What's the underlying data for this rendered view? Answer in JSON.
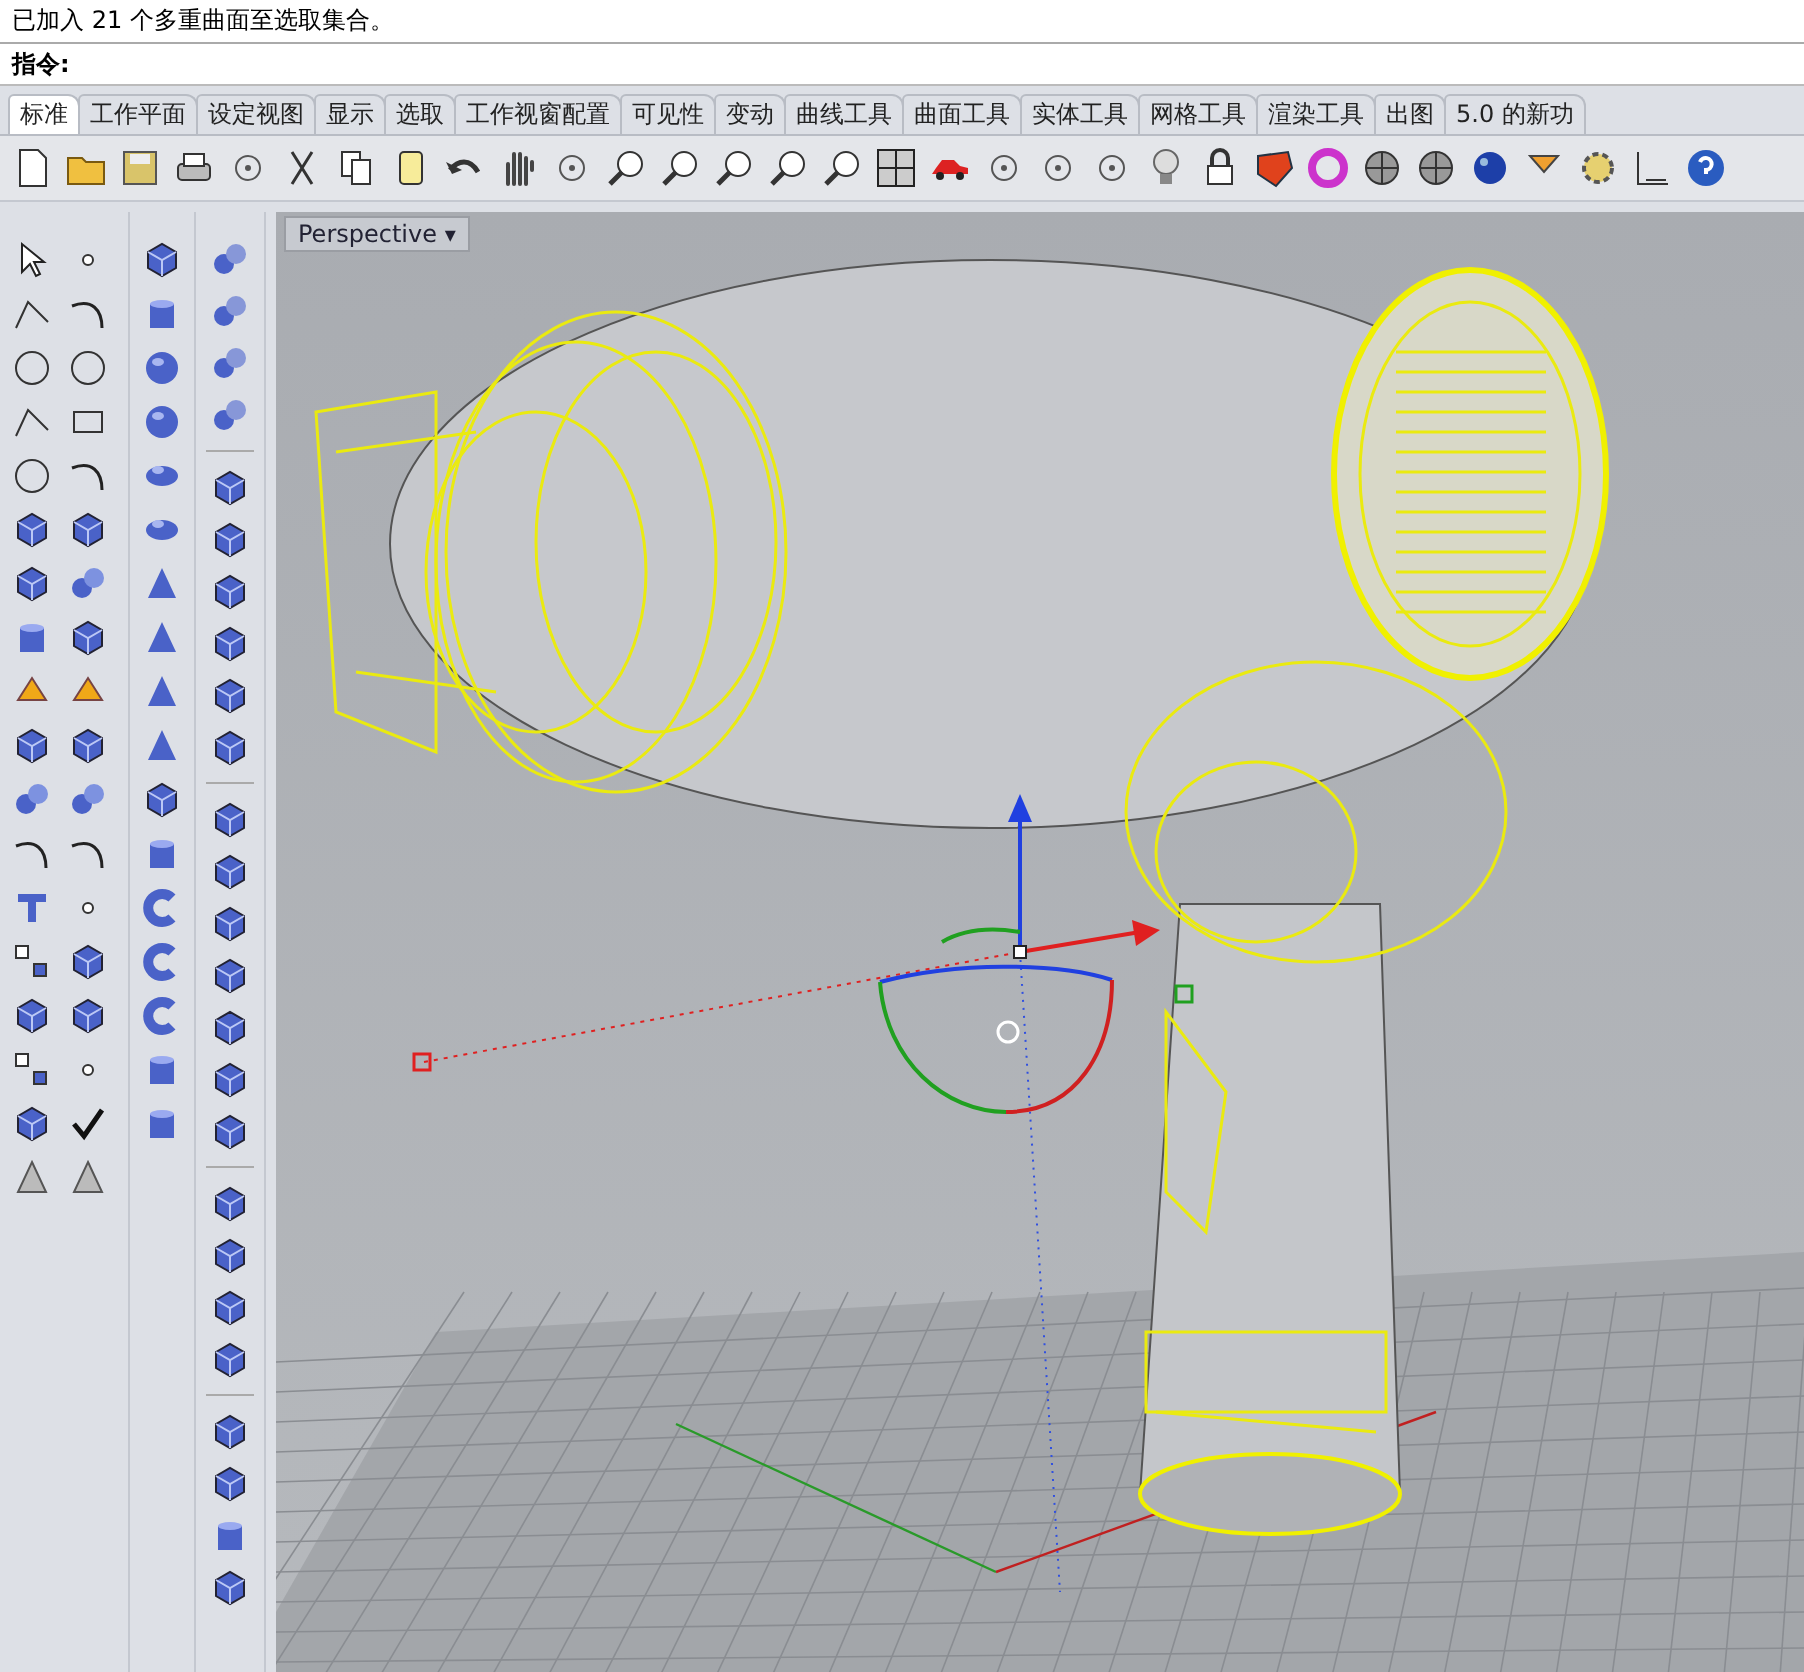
{
  "command_history": {
    "text": "已加入 21 个多重曲面至选取集合。"
  },
  "command_prompt": {
    "label": "指令:"
  },
  "tabs": [
    {
      "label": "标准",
      "selected": true
    },
    {
      "label": "工作平面",
      "selected": false
    },
    {
      "label": "设定视图",
      "selected": false
    },
    {
      "label": "显示",
      "selected": false
    },
    {
      "label": "选取",
      "selected": false
    },
    {
      "label": "工作视窗配置",
      "selected": false
    },
    {
      "label": "可见性",
      "selected": false
    },
    {
      "label": "变动",
      "selected": false
    },
    {
      "label": "曲线工具",
      "selected": false
    },
    {
      "label": "曲面工具",
      "selected": false
    },
    {
      "label": "实体工具",
      "selected": false
    },
    {
      "label": "网格工具",
      "selected": false
    },
    {
      "label": "渲染工具",
      "selected": false
    },
    {
      "label": "出图",
      "selected": false
    },
    {
      "label": "5.0 的新功",
      "selected": false
    }
  ],
  "viewport": {
    "title": "Perspective",
    "menu_glyph": "▾"
  }
}
